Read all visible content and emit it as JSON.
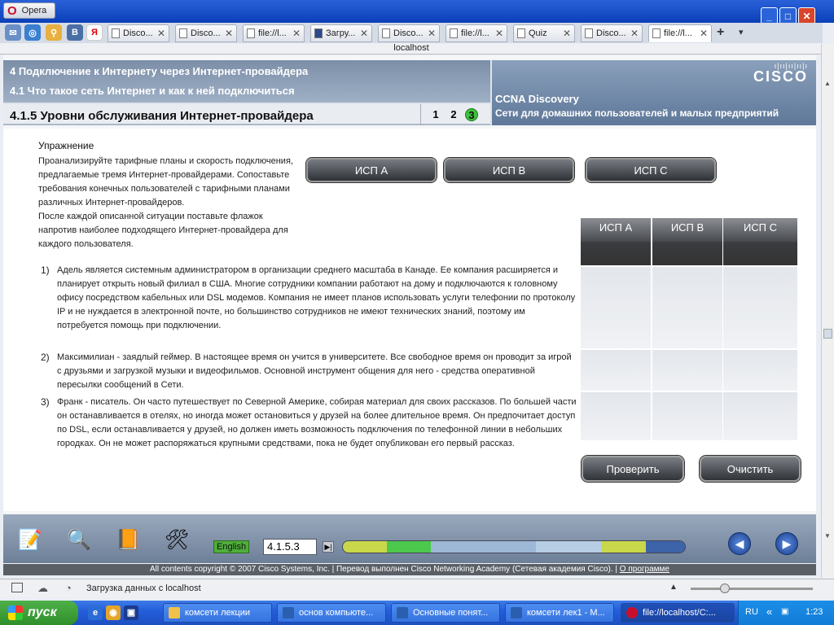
{
  "browser": {
    "menu_label": "Opera",
    "address": "localhost",
    "tabs": [
      {
        "label": "Disco..."
      },
      {
        "label": "Disco..."
      },
      {
        "label": "file://l..."
      },
      {
        "label": "Загру..."
      },
      {
        "label": "Disco..."
      },
      {
        "label": "file://l..."
      },
      {
        "label": "Quiz"
      },
      {
        "label": "Disco..."
      },
      {
        "label": "file://l..."
      }
    ],
    "status_text": "Загрузка данных с localhost"
  },
  "header": {
    "module_title": "4 Подключение к Интернету через Интернет-провайдера",
    "section_title": "4.1 Что такое сеть Интернет и как к ней подключиться",
    "page_title": "4.1.5 Уровни обслуживания Интернет-провайдера",
    "pages": [
      "1",
      "2",
      "3"
    ],
    "current_page": "3",
    "brand": "CISCO",
    "course": "CCNA Discovery",
    "course_sub": "Сети для домашних пользователей и малых предприятий"
  },
  "exercise": {
    "title": "Упражнение",
    "instructions_1": "Проанализируйте тарифные планы и скорость подключения, предлагаемые тремя Интернет-провайдерами. Сопоставьте требования конечных пользователей с тарифными планами различных Интернет-провайдеров.",
    "instructions_2": "После каждой описанной ситуации поставьте флажок напротив наиболее подходящего Интернет-провайдера для каждого пользователя.",
    "isp_buttons": [
      "ИСП A",
      "ИСП B",
      "ИСП C"
    ],
    "grid_headers": [
      "ИСП A",
      "ИСП B",
      "ИСП C"
    ],
    "scenarios": [
      {
        "num": "1)",
        "text": "Адель является системным администратором в организации среднего масштаба в Канаде. Ее компания расширяется и планирует открыть новый филиал в США. Многие сотрудники компании работают на дому и подключаются к головному офису посредством кабельных или DSL модемов. Компания не имеет планов использовать услуги телефонии по протоколу IP и не нуждается в электронной почте, но большинство сотрудников не имеют технических знаний, поэтому им потребуется помощь при подключении."
      },
      {
        "num": "2)",
        "text": "Максимилиан - заядлый геймер. В настоящее время он учится в университете. Все свободное время он проводит за игрой с друзьями и загрузкой музыки и видеофильмов. Основной инструмент общения для него - средства оперативной пересылки сообщений в Сети."
      },
      {
        "num": "3)",
        "text": "Франк - писатель. Он часто путешествует по Северной Америке, собирая материал для своих рассказов. По большей части он останавливается в отелях, но иногда может остановиться у друзей на более длительное время. Он предпочитает доступ по DSL, если останавливается у друзей, но должен иметь возможность подключения по телефонной линии в небольших городках. Он не может распоряжаться крупными средствами, пока не будет опубликован его первый рассказ."
      }
    ],
    "check_label": "Проверить",
    "clear_label": "Очистить"
  },
  "footer": {
    "language": "English",
    "page_field": "4.1.5.3",
    "copyright": "All contents copyright © 2007 Cisco Systems, Inc. | Перевод выполнен Cisco Networking Academy (Сетевая академия Cisco). |",
    "about_link": "О программе",
    "progress_colors": [
      "#c9d84a",
      "#4cc94c",
      "#9db8d6",
      "#b7cde3",
      "#c9d84a",
      "#3d63a8"
    ]
  },
  "taskbar": {
    "start": "пуск",
    "tasks": [
      {
        "label": "комсети лекции"
      },
      {
        "label": "основ компьюте..."
      },
      {
        "label": "Основные понят..."
      },
      {
        "label": "комсети лек1 - М..."
      },
      {
        "label": "file://localhost/C:..."
      }
    ],
    "lang": "RU",
    "clock": "1:23"
  }
}
